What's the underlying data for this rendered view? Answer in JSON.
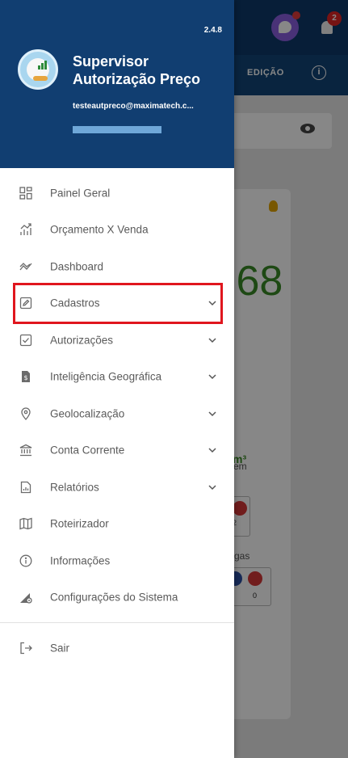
{
  "background": {
    "tab_edicao": "EDIÇÃO",
    "info_glyph": "i",
    "notification_count": "2",
    "big_number": ".68",
    "m3_label": "m³",
    "text_em": "em",
    "text_gas": "gas",
    "text_box1": "2",
    "text_box2": "0"
  },
  "drawer": {
    "version": "2.4.8",
    "user_name": "Supervisor Autorização Preço",
    "user_email": "testeautpreco@maximatech.c...",
    "menu": [
      {
        "label": "Painel Geral",
        "icon": "grid-icon",
        "has_chevron": false
      },
      {
        "label": "Orçamento X Venda",
        "icon": "chart-trend-icon",
        "has_chevron": false
      },
      {
        "label": "Dashboard",
        "icon": "trend-icon",
        "has_chevron": false
      },
      {
        "label": "Cadastros",
        "icon": "edit-box-icon",
        "has_chevron": true
      },
      {
        "label": "Autorizações",
        "icon": "checkbox-icon",
        "has_chevron": true
      },
      {
        "label": "Inteligência Geográfica",
        "icon": "document-dollar-icon",
        "has_chevron": true
      },
      {
        "label": "Geolocalização",
        "icon": "location-pin-icon",
        "has_chevron": true
      },
      {
        "label": "Conta Corrente",
        "icon": "bank-icon",
        "has_chevron": true
      },
      {
        "label": "Relatórios",
        "icon": "report-icon",
        "has_chevron": true
      },
      {
        "label": "Roteirizador",
        "icon": "map-icon",
        "has_chevron": false
      },
      {
        "label": "Informações",
        "icon": "info-icon",
        "has_chevron": false
      },
      {
        "label": "Configurações do Sistema",
        "icon": "settings-icon",
        "has_chevron": false
      }
    ],
    "logout_label": "Sair"
  },
  "colors": {
    "header": "#113e71",
    "highlight": "#e0161e",
    "accent_green": "#3a8a26"
  }
}
